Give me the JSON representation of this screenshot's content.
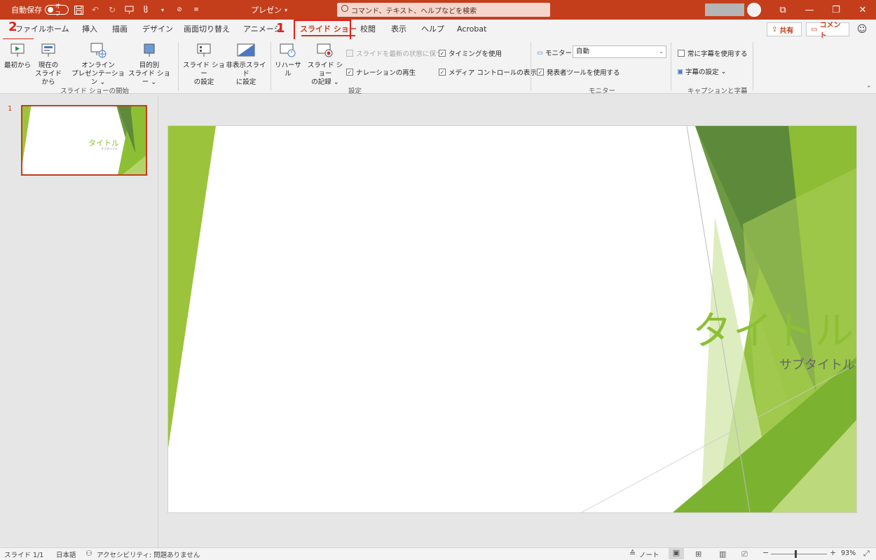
{
  "titlebar": {
    "autosave_label": "自動保存",
    "autosave_state": "オフ",
    "doc_title": "プレゼン",
    "search_placeholder": "コマンド、テキスト、ヘルプなどを検索"
  },
  "tabs": [
    "ファイル",
    "ホーム",
    "挿入",
    "描画",
    "デザイン",
    "画面切り替え",
    "アニメーション",
    "スライド ショー",
    "校閲",
    "表示",
    "ヘルプ",
    "Acrobat"
  ],
  "active_tab": "スライド ショー",
  "share_label": "共有",
  "comment_label": "コメント",
  "annotations": {
    "step1": "1",
    "step2": "2"
  },
  "ribbon": {
    "start": {
      "from_beginning": "最初から",
      "from_current_l1": "現在の",
      "from_current_l2": "スライドから",
      "online_l1": "オンライン",
      "online_l2": "プレゼンテーション",
      "custom_l1": "目的別",
      "custom_l2": "スライド ショー",
      "group": "スライド ショーの開始"
    },
    "setup": {
      "setup_l1": "スライド ショー",
      "setup_l2": "の設定",
      "hide_l1": "非表示スライド",
      "hide_l2": "に設定",
      "rehearse": "リハーサル",
      "record_l1": "スライド ショー",
      "record_l2": "の記録",
      "keep_updated": "スライドを最新の状態に保つ",
      "play_narration": "ナレーションの再生",
      "use_timings": "タイミングを使用",
      "show_media": "メディア コントロールの表示",
      "group": "設定"
    },
    "monitor": {
      "monitor_label": "モニター:",
      "monitor_value": "自動",
      "presenter_view": "発表者ツールを使用する",
      "group": "モニター"
    },
    "captions": {
      "always_subtitles": "常に字幕を使用する",
      "subtitle_settings": "字幕の設定",
      "group": "キャプションと字幕"
    }
  },
  "thumb": {
    "number": "1",
    "title": "タイトル",
    "subtitle": "サブタイトル"
  },
  "slide": {
    "title": "タイトル",
    "subtitle": "サブタイトル"
  },
  "status": {
    "slide_count": "スライド 1/1",
    "language": "日本語",
    "accessibility": "アクセシビリティ: 問題ありません",
    "notes": "ノート",
    "zoom": "93%"
  },
  "colors": {
    "accent": "#c43e1c",
    "highlight": "#e0201b",
    "slide_green": "#8dbf34"
  }
}
